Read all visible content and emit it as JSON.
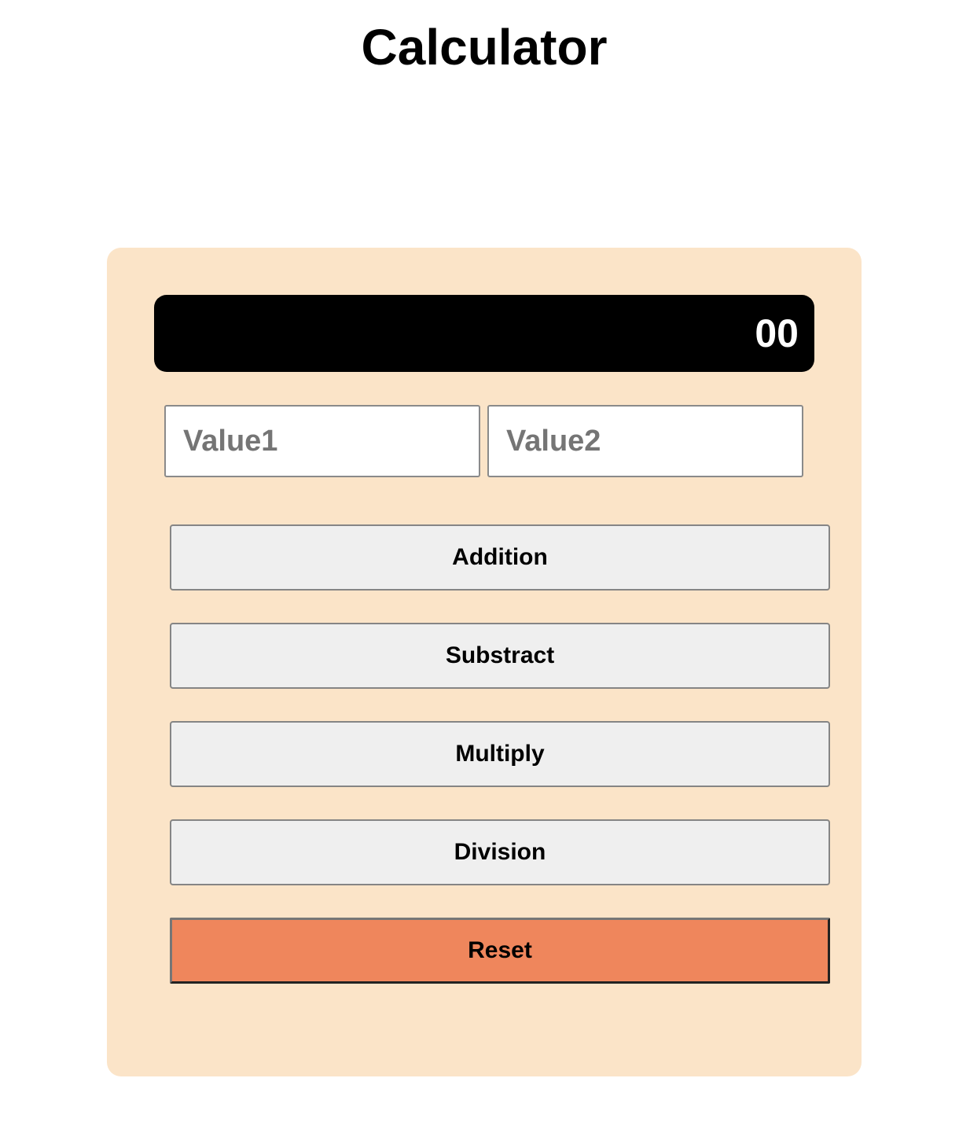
{
  "page": {
    "title": "Calculator"
  },
  "calculator": {
    "display_value": "00",
    "inputs": {
      "value1": {
        "value": "",
        "placeholder": "Value1"
      },
      "value2": {
        "value": "",
        "placeholder": "Value2"
      }
    },
    "buttons": {
      "addition": "Addition",
      "subtract": "Substract",
      "multiply": "Multiply",
      "division": "Division",
      "reset": "Reset"
    }
  },
  "colors": {
    "panel_background": "#fbe4c8",
    "display_background": "#000000",
    "display_text": "#ffffff",
    "button_background": "#efefef",
    "reset_background": "#ef865c"
  }
}
